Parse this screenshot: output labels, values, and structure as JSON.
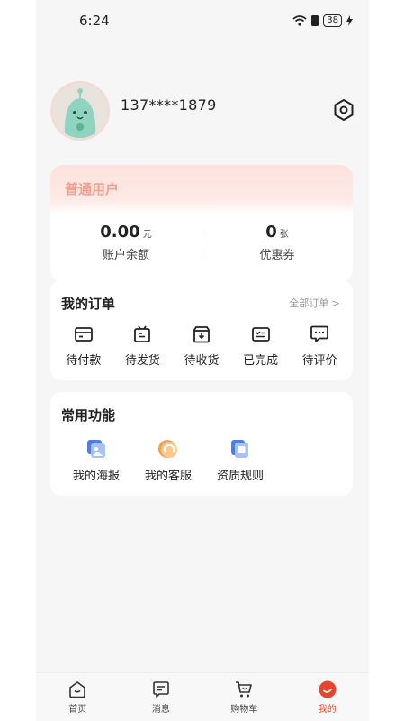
{
  "status_bar": {
    "time": "6:24",
    "battery": "38"
  },
  "profile": {
    "phone": "137****1879"
  },
  "member": {
    "title": "普通用户",
    "balance_value": "0.00",
    "balance_unit": "元",
    "balance_label": "账户余额",
    "coupon_value": "0",
    "coupon_unit": "张",
    "coupon_label": "优惠券"
  },
  "orders": {
    "title": "我的订单",
    "all_link": "全部订单 >",
    "items": [
      {
        "label": "待付款",
        "icon": "wallet-icon"
      },
      {
        "label": "待发货",
        "icon": "package-icon"
      },
      {
        "label": "待收货",
        "icon": "box-download-icon"
      },
      {
        "label": "已完成",
        "icon": "completed-icon"
      },
      {
        "label": "待评价",
        "icon": "comment-icon"
      }
    ]
  },
  "features": {
    "title": "常用功能",
    "items": [
      {
        "label": "我的海报",
        "icon": "poster-icon"
      },
      {
        "label": "我的客服",
        "icon": "customer-service-icon"
      },
      {
        "label": "资质规则",
        "icon": "qualification-icon"
      }
    ]
  },
  "tabbar": {
    "items": [
      {
        "label": "首页",
        "icon": "home-icon"
      },
      {
        "label": "消息",
        "icon": "message-icon"
      },
      {
        "label": "购物车",
        "icon": "cart-icon"
      },
      {
        "label": "我的",
        "icon": "profile-icon",
        "active": true
      }
    ]
  },
  "colors": {
    "accent": "#e8452c",
    "member_title": "#f0a08f",
    "feature_blue": "#4a7ee8",
    "feature_orange": "#f0a050"
  }
}
